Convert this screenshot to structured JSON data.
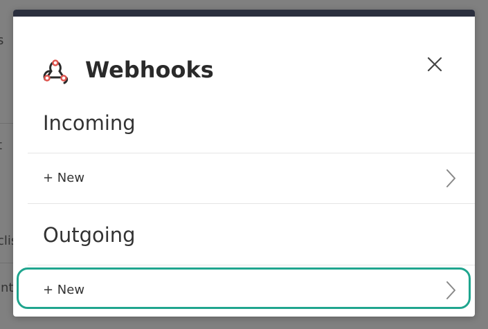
{
  "background": {
    "fragments": [
      "s",
      "t",
      "clis",
      "int"
    ]
  },
  "modal": {
    "title": "Webhooks",
    "icon": "webhook-icon",
    "close_icon": "close-icon"
  },
  "sections": [
    {
      "heading": "Incoming",
      "rows": [
        {
          "label": "+ New",
          "icon": "chevron-right-icon"
        }
      ]
    },
    {
      "heading": "Outgoing",
      "rows": [
        {
          "label": "+ New",
          "icon": "chevron-right-icon",
          "highlighted": true
        }
      ]
    }
  ],
  "colors": {
    "topbar": "#2b2f3e",
    "accent_icon": "#e0554f",
    "highlight_outline": "#1fa58e",
    "overlay": "#808080"
  }
}
